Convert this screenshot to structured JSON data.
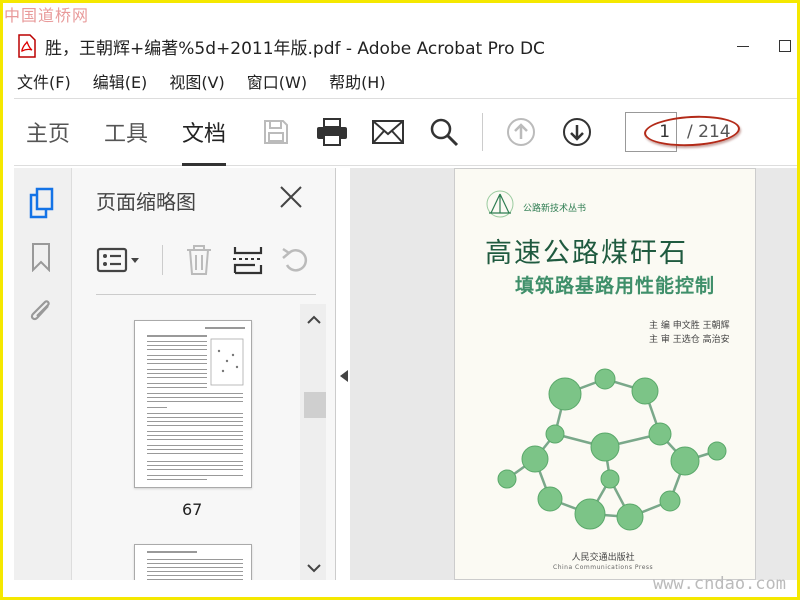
{
  "watermarks": {
    "top": "中国道桥网",
    "bottom": "www.cndao.com"
  },
  "window": {
    "title": "胜，王朝辉+编著%5d+2011年版.pdf - Adobe Acrobat Pro DC"
  },
  "menu": {
    "items": [
      "文件(F)",
      "编辑(E)",
      "视图(V)",
      "窗口(W)",
      "帮助(H)"
    ]
  },
  "toolbar": {
    "tabs": [
      "主页",
      "工具",
      "文档"
    ],
    "active_tab": "文档",
    "icons": [
      "save-icon",
      "print-icon",
      "email-icon",
      "search-icon",
      "page-up-icon",
      "page-down-icon"
    ],
    "page_current": "1",
    "page_total": "/ 214"
  },
  "side_panel": {
    "title": "页面缩略图",
    "thumbnail_page_label": "67",
    "rail_icons": [
      "page-thumbnails-icon",
      "bookmark-icon",
      "attachment-icon"
    ]
  },
  "document": {
    "series": "公路新技术丛书",
    "title": "高速公路煤矸石",
    "subtitle": "填筑路基路用性能控制",
    "authors_line1": "主  编  申文胜  王朝辉",
    "authors_line2": "主  审  王选仓  高治安",
    "publisher": "人民交通出版社",
    "publisher_en": "China Communications Press"
  },
  "colors": {
    "accent_oval": "#b32a18",
    "cover_green": "#1f5a3f",
    "molecule": "#7cc487",
    "frame": "#f5e800"
  }
}
